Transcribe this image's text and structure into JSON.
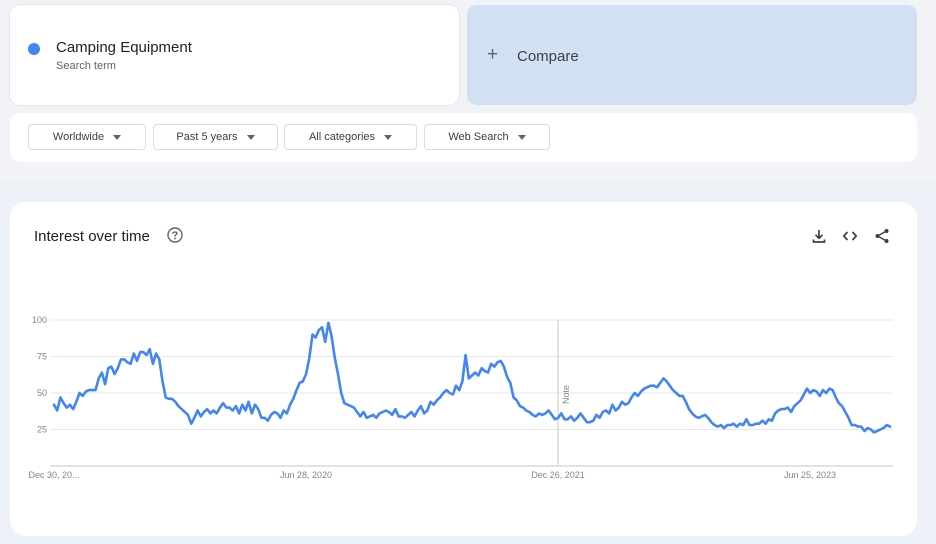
{
  "search_term": {
    "name": "Camping Equipment",
    "subtitle": "Search term",
    "color": "#4285f4"
  },
  "compare": {
    "label": "Compare",
    "icon": "plus-icon"
  },
  "filters": [
    {
      "label": "Worldwide"
    },
    {
      "label": "Past 5 years"
    },
    {
      "label": "All categories"
    },
    {
      "label": "Web Search"
    }
  ],
  "chart_panel": {
    "title": "Interest over time",
    "icons": [
      "help-icon",
      "download-icon",
      "embed-icon",
      "share-icon"
    ]
  },
  "chart_data": {
    "type": "line",
    "title": "Interest over time",
    "xlabel": "",
    "ylabel": "",
    "ylim": [
      0,
      100
    ],
    "y_ticks": [
      "100",
      "75",
      "50",
      "25"
    ],
    "x_tick_labels": [
      "Dec 30, 20...",
      "Jun 28, 2020",
      "Dec 26, 2021",
      "Jun 25, 2023"
    ],
    "annotation": {
      "text": "Note",
      "x": "Dec 26, 2021"
    },
    "grid": true,
    "series": [
      {
        "color": "#4285f4",
        "x_start": "2018-12-30",
        "x_end": "2023-12-24",
        "values": [
          42,
          38,
          47,
          43,
          40,
          42,
          39,
          44,
          50,
          48,
          51,
          52,
          52,
          52,
          60,
          64,
          56,
          67,
          68,
          63,
          67,
          73,
          73,
          71,
          70,
          77,
          72,
          78,
          78,
          76,
          80,
          70,
          77,
          73,
          58,
          47,
          46,
          46,
          44,
          41,
          39,
          37,
          35,
          29,
          33,
          38,
          34,
          37,
          39,
          36,
          38,
          36,
          40,
          43,
          40,
          40,
          38,
          41,
          36,
          42,
          38,
          44,
          36,
          42,
          39,
          33,
          33,
          31,
          35,
          37,
          36,
          33,
          38,
          36,
          42,
          46,
          52,
          57,
          58,
          63,
          74,
          90,
          88,
          93,
          95,
          85,
          98,
          89,
          74,
          63,
          50,
          43,
          42,
          41,
          40,
          37,
          34,
          37,
          33,
          34,
          35,
          33,
          36,
          37,
          38,
          37,
          35,
          39,
          34,
          34,
          33,
          35,
          37,
          34,
          38,
          41,
          36,
          38,
          44,
          42,
          45,
          47,
          50,
          52,
          50,
          49,
          55,
          52,
          58,
          76,
          60,
          62,
          64,
          62,
          67,
          65,
          64,
          70,
          68,
          71,
          72,
          68,
          61,
          57,
          47,
          45,
          41,
          40,
          38,
          37,
          35,
          34,
          36,
          35,
          36,
          38,
          35,
          32,
          33,
          36,
          32,
          32,
          34,
          31,
          33,
          36,
          33,
          30,
          30,
          31,
          35,
          33,
          37,
          38,
          36,
          42,
          38,
          40,
          44,
          42,
          43,
          47,
          50,
          48,
          51,
          53,
          54,
          55,
          55,
          54,
          57,
          60,
          58,
          55,
          52,
          50,
          48,
          48,
          44,
          39,
          36,
          34,
          33,
          34,
          35,
          33,
          30,
          28,
          27,
          28,
          26,
          28,
          28,
          29,
          27,
          29,
          28,
          32,
          28,
          28,
          29,
          29,
          31,
          29,
          32,
          31,
          36,
          38,
          39,
          39,
          40,
          37,
          41,
          43,
          45,
          49,
          53,
          50,
          52,
          51,
          48,
          52,
          50,
          53,
          52,
          47,
          43,
          41,
          37,
          33,
          28,
          28,
          27,
          27,
          24,
          26,
          25,
          23,
          24,
          25,
          26,
          28,
          27
        ]
      }
    ]
  }
}
